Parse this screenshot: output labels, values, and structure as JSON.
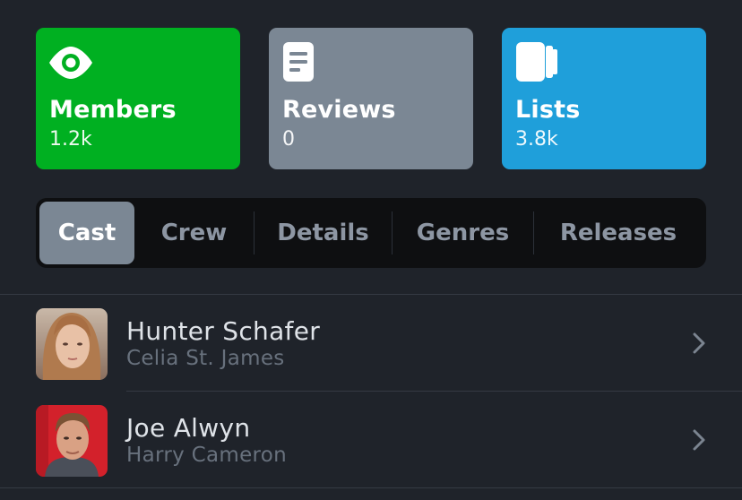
{
  "stats": [
    {
      "label": "Members",
      "count": "1.2k",
      "color": "#00b021",
      "icon": "eye-icon"
    },
    {
      "label": "Reviews",
      "count": "0",
      "color": "#7b8794",
      "icon": "document-icon"
    },
    {
      "label": "Lists",
      "count": "3.8k",
      "color": "#1f9fda",
      "icon": "lists-icon"
    }
  ],
  "tabs": [
    {
      "label": "Cast",
      "active": true
    },
    {
      "label": "Crew",
      "active": false
    },
    {
      "label": "Details",
      "active": false
    },
    {
      "label": "Genres",
      "active": false
    },
    {
      "label": "Releases",
      "active": false
    }
  ],
  "cast": [
    {
      "name": "Hunter Schafer",
      "role": "Celia St. James"
    },
    {
      "name": "Joe Alwyn",
      "role": "Harry Cameron"
    }
  ]
}
